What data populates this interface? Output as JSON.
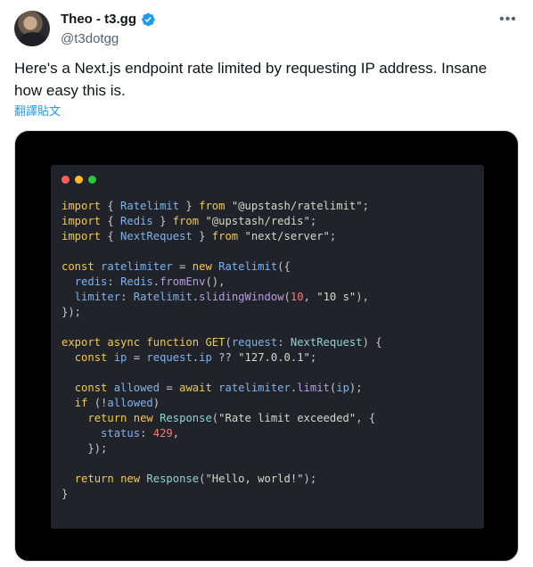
{
  "author": {
    "display_name": "Theo - t3.gg",
    "handle": "@t3dotgg",
    "more_icon": "more-icon",
    "verified_color": "#1d9bf0"
  },
  "tweet": {
    "text": "Here's a Next.js endpoint rate limited by requesting IP address. Insane how easy this is.",
    "translate_label": "翻譯貼文"
  },
  "code_colors": {
    "keyword": "#f2c94c",
    "plain": "#c8c8c8",
    "ident": "#7fb2e8",
    "string": "#d7d7c8",
    "number": "#f27a7a",
    "method": "#b89be0",
    "type": "#8fd3c8"
  },
  "code_lines": [
    [
      [
        "keyword",
        "import"
      ],
      [
        "plain",
        " { "
      ],
      [
        "ident",
        "Ratelimit"
      ],
      [
        "plain",
        " } "
      ],
      [
        "keyword",
        "from"
      ],
      [
        "plain",
        " "
      ],
      [
        "string",
        "\"@upstash/ratelimit\""
      ],
      [
        "plain",
        ";"
      ]
    ],
    [
      [
        "keyword",
        "import"
      ],
      [
        "plain",
        " { "
      ],
      [
        "ident",
        "Redis"
      ],
      [
        "plain",
        " } "
      ],
      [
        "keyword",
        "from"
      ],
      [
        "plain",
        " "
      ],
      [
        "string",
        "\"@upstash/redis\""
      ],
      [
        "plain",
        ";"
      ]
    ],
    [
      [
        "keyword",
        "import"
      ],
      [
        "plain",
        " { "
      ],
      [
        "ident",
        "NextRequest"
      ],
      [
        "plain",
        " } "
      ],
      [
        "keyword",
        "from"
      ],
      [
        "plain",
        " "
      ],
      [
        "string",
        "\"next/server\""
      ],
      [
        "plain",
        ";"
      ]
    ],
    [],
    [
      [
        "keyword",
        "const"
      ],
      [
        "plain",
        " "
      ],
      [
        "ident",
        "ratelimiter"
      ],
      [
        "plain",
        " = "
      ],
      [
        "keyword",
        "new"
      ],
      [
        "plain",
        " "
      ],
      [
        "ident",
        "Ratelimit"
      ],
      [
        "plain",
        "({"
      ]
    ],
    [
      [
        "plain",
        "  "
      ],
      [
        "ident",
        "redis"
      ],
      [
        "plain",
        ": "
      ],
      [
        "ident",
        "Redis"
      ],
      [
        "plain",
        "."
      ],
      [
        "method",
        "fromEnv"
      ],
      [
        "plain",
        "(),"
      ]
    ],
    [
      [
        "plain",
        "  "
      ],
      [
        "ident",
        "limiter"
      ],
      [
        "plain",
        ": "
      ],
      [
        "ident",
        "Ratelimit"
      ],
      [
        "plain",
        "."
      ],
      [
        "method",
        "slidingWindow"
      ],
      [
        "plain",
        "("
      ],
      [
        "number",
        "10"
      ],
      [
        "plain",
        ", "
      ],
      [
        "string",
        "\"10 s\""
      ],
      [
        "plain",
        "),"
      ]
    ],
    [
      [
        "plain",
        "});"
      ]
    ],
    [],
    [
      [
        "keyword",
        "export"
      ],
      [
        "plain",
        " "
      ],
      [
        "keyword",
        "async"
      ],
      [
        "plain",
        " "
      ],
      [
        "keyword",
        "function"
      ],
      [
        "plain",
        " "
      ],
      [
        "keyword",
        "GET"
      ],
      [
        "plain",
        "("
      ],
      [
        "ident",
        "request"
      ],
      [
        "plain",
        ": "
      ],
      [
        "type",
        "NextRequest"
      ],
      [
        "plain",
        ") {"
      ]
    ],
    [
      [
        "plain",
        "  "
      ],
      [
        "keyword",
        "const"
      ],
      [
        "plain",
        " "
      ],
      [
        "ident",
        "ip"
      ],
      [
        "plain",
        " = "
      ],
      [
        "ident",
        "request"
      ],
      [
        "plain",
        "."
      ],
      [
        "ident",
        "ip"
      ],
      [
        "plain",
        " ?? "
      ],
      [
        "string",
        "\"127.0.0.1\""
      ],
      [
        "plain",
        ";"
      ]
    ],
    [],
    [
      [
        "plain",
        "  "
      ],
      [
        "keyword",
        "const"
      ],
      [
        "plain",
        " "
      ],
      [
        "ident",
        "allowed"
      ],
      [
        "plain",
        " = "
      ],
      [
        "keyword",
        "await"
      ],
      [
        "plain",
        " "
      ],
      [
        "ident",
        "ratelimiter"
      ],
      [
        "plain",
        "."
      ],
      [
        "method",
        "limit"
      ],
      [
        "plain",
        "("
      ],
      [
        "ident",
        "ip"
      ],
      [
        "plain",
        ");"
      ]
    ],
    [
      [
        "plain",
        "  "
      ],
      [
        "keyword",
        "if"
      ],
      [
        "plain",
        " (!"
      ],
      [
        "ident",
        "allowed"
      ],
      [
        "plain",
        ")"
      ]
    ],
    [
      [
        "plain",
        "    "
      ],
      [
        "keyword",
        "return"
      ],
      [
        "plain",
        " "
      ],
      [
        "keyword",
        "new"
      ],
      [
        "plain",
        " "
      ],
      [
        "type",
        "Response"
      ],
      [
        "plain",
        "("
      ],
      [
        "string",
        "\"Rate limit exceeded\""
      ],
      [
        "plain",
        ", {"
      ]
    ],
    [
      [
        "plain",
        "      "
      ],
      [
        "ident",
        "status"
      ],
      [
        "plain",
        ": "
      ],
      [
        "number",
        "429"
      ],
      [
        "plain",
        ","
      ]
    ],
    [
      [
        "plain",
        "    });"
      ]
    ],
    [],
    [
      [
        "plain",
        "  "
      ],
      [
        "keyword",
        "return"
      ],
      [
        "plain",
        " "
      ],
      [
        "keyword",
        "new"
      ],
      [
        "plain",
        " "
      ],
      [
        "type",
        "Response"
      ],
      [
        "plain",
        "("
      ],
      [
        "string",
        "\"Hello, world!\""
      ],
      [
        "plain",
        ");"
      ]
    ],
    [
      [
        "plain",
        "}"
      ]
    ]
  ]
}
